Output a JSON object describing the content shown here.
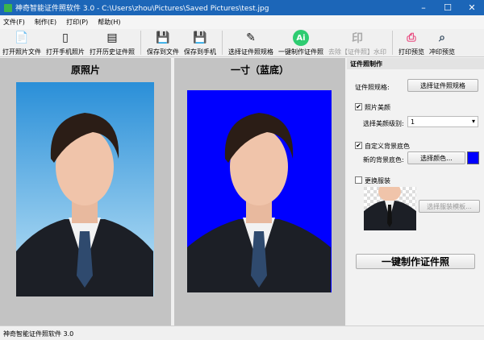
{
  "window": {
    "title": "神奇智能证件照软件 3.0 - C:\\Users\\zhou\\Pictures\\Saved Pictures\\test.jpg",
    "minimize": "–",
    "maximize": "☐",
    "close": "✕"
  },
  "menu": [
    "文件(F)",
    "制作(E)",
    "打印(P)",
    "帮助(H)"
  ],
  "toolbar": [
    {
      "label": "打开照片文件",
      "icon": "open-file-icon",
      "glyph": "📄",
      "color": "#4a6fa5"
    },
    {
      "label": "打开手机照片",
      "icon": "phone-icon",
      "glyph": "▯",
      "color": "#111111"
    },
    {
      "label": "打开历史证件照",
      "icon": "history-icon",
      "glyph": "▤",
      "color": "#111111"
    },
    {
      "label": "保存到文件",
      "icon": "save-icon",
      "glyph": "💾",
      "color": "#7d3c98"
    },
    {
      "label": "保存到手机",
      "icon": "save-phone-icon",
      "glyph": "💾",
      "color": "#7d3c98"
    },
    {
      "label": "选择证件照规格",
      "icon": "ruler-pencil-icon",
      "glyph": "✎",
      "color": "#111111"
    },
    {
      "label": "一键制作证件照",
      "icon": "ai-icon",
      "glyph": "Ai",
      "color": "#2ecc71"
    },
    {
      "label": "去除【证件照】水印",
      "icon": "watermark-icon",
      "glyph": "印",
      "color": "#aaaaaa",
      "disabled": true
    },
    {
      "label": "打印预览",
      "icon": "printer-icon",
      "glyph": "⎙",
      "color": "#e84a7f"
    },
    {
      "label": "冲印预览",
      "icon": "print-preview-icon",
      "glyph": "⌕",
      "color": "#34495e"
    }
  ],
  "left": {
    "title": "原照片"
  },
  "right": {
    "title": "一寸（蓝底）",
    "bg": "#0000ff"
  },
  "side": {
    "header": "证件照制作",
    "spec_label": "证件照规格:",
    "spec_button": "选择证件照规格",
    "beauty_label": "照片美颜",
    "beauty_checked": true,
    "level_label": "选择美颜级别:",
    "level_value": "1",
    "custom_bg_label": "自定义背景底色",
    "custom_bg_checked": true,
    "new_bg_label": "新的背景底色:",
    "color_button": "选择颜色...",
    "color": "#0000ff",
    "clothes_label": "更换服装",
    "clothes_checked": false,
    "clothes_button": "选择服装模板...",
    "make_button": "一键制作证件照"
  },
  "status": "神奇智能证件照软件 3.0"
}
